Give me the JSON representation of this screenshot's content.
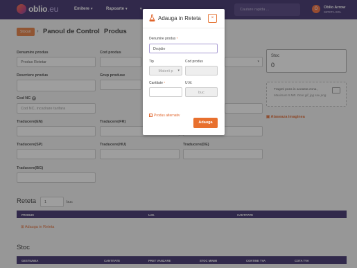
{
  "app": {
    "logo_main": "oblio",
    "logo_tld": ".eu"
  },
  "nav": [
    {
      "label": "Emitere"
    },
    {
      "label": "Rapoarte"
    }
  ],
  "search": {
    "placeholder": "Cautare rapida ..."
  },
  "user": {
    "initial": "O",
    "name": "Oblio Arrow",
    "company": "SIPETA SRL"
  },
  "breadcrumb": {
    "stocuri": "Stocuri",
    "panou": "Panoul de Control",
    "produs": "Produs"
  },
  "form": {
    "denumire_label": "Denumire produs",
    "denumire_value": "Produs Retetar",
    "cod_produs_label": "Cod produs",
    "descriere_label": "Descriere produs",
    "grup_label": "Grup produse",
    "cod_nc_label": "Cod NC",
    "cod_nc_placeholder": "Cod NC, incadrare tarifara",
    "traducere_en": "Traducere(EN)",
    "traducere_fr": "Traducere(FR)",
    "traducere_sp": "Traducere(SP)",
    "traducere_hu": "Traducere(HU)",
    "traducere_de": "Traducere(DE)",
    "traducere_bg": "Traducere(BG)"
  },
  "stoc_box": {
    "title": "Stoc",
    "value": "0"
  },
  "image_upload": {
    "hint": "Trageti poza in aceasta zona ,",
    "limits": "Maximum 5 MB. Doar gif, jpg sau png.",
    "attach_link": "Ataseaza imaginea"
  },
  "reteta": {
    "title": "Reteta",
    "qty": "1",
    "unit": "buc",
    "columns": [
      "PRODUS",
      "U.M.",
      "CANTITATE"
    ],
    "add_link": "Adauga in Reteta"
  },
  "stoc": {
    "title": "Stoc",
    "columns": [
      "GESTIUNEA",
      "CANTITATE",
      "PRET VANZARE",
      "STOC MINIM",
      "CONTINE TVA",
      "COTA TVA"
    ]
  },
  "modal": {
    "title": "Adauga in Reteta",
    "close": "×",
    "denumire_label": "Denumire produs",
    "denumire_value": "Drojdie",
    "tip_label": "Tip",
    "tip_value": "Materii p",
    "cod_label": "Cod produs",
    "cantitate_label": "Cantitate",
    "um_label": "U.M.",
    "um_value": "buc",
    "alt_label": "Produs alternativ",
    "submit": "Adauga"
  },
  "colors": {
    "topbar": "#3a2a68",
    "accent": "#e8702e"
  }
}
